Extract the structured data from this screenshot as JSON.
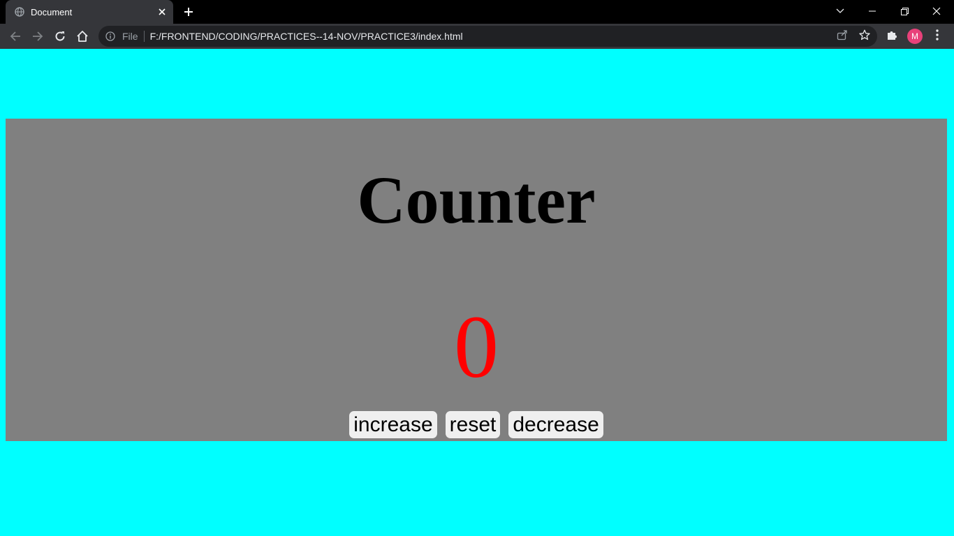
{
  "browser": {
    "tab_title": "Document",
    "scheme_label": "File",
    "url": "F:/FRONTEND/CODING/PRACTICES--14-NOV/PRACTICE3/index.html",
    "profile_initial": "M"
  },
  "page": {
    "heading": "Counter",
    "counter_value": "0",
    "buttons": {
      "increase": "increase",
      "reset": "reset",
      "decrease": "decrease"
    }
  },
  "colors": {
    "page_background": "#00ffff",
    "panel_background": "#808080",
    "counter_value": "#ff0000",
    "profile_avatar": "#e8417a"
  }
}
